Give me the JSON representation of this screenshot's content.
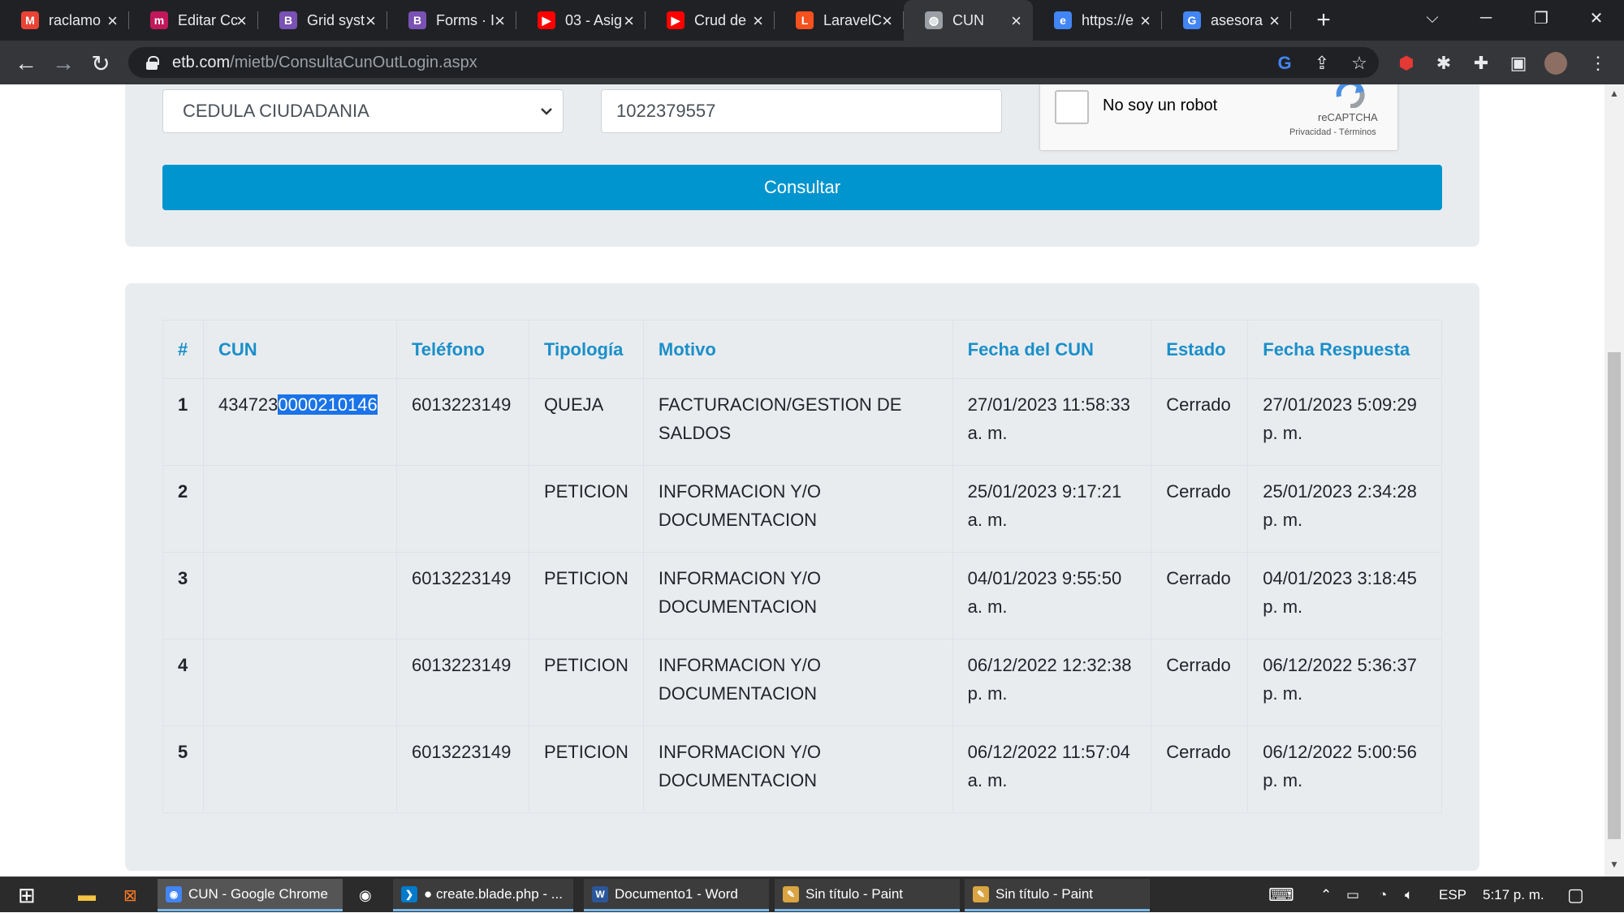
{
  "browser": {
    "tabs": [
      {
        "title": "raclamo",
        "favicon": "gmail-icon",
        "color": "#ea4335"
      },
      {
        "title": "Editar Cc",
        "favicon": "moodle-icon",
        "color": "#c2185b"
      },
      {
        "title": "Grid syst",
        "favicon": "bootstrap-icon",
        "color": "#7952b3"
      },
      {
        "title": "Forms · I",
        "favicon": "bootstrap-icon",
        "color": "#7952b3"
      },
      {
        "title": "03 - Asig",
        "favicon": "youtube-icon",
        "color": "#ff0000"
      },
      {
        "title": "Crud de",
        "favicon": "youtube-icon",
        "color": "#ff0000"
      },
      {
        "title": "LaravelC",
        "favicon": "laravel-icon",
        "color": "#f4511e"
      },
      {
        "title": "CUN",
        "favicon": "globe-icon",
        "color": "#9aa0a6"
      },
      {
        "title": "https://e",
        "favicon": "edge-icon",
        "color": "#4285f4"
      },
      {
        "title": "asesora",
        "favicon": "google-icon",
        "color": "#4285f4"
      }
    ],
    "url_domain": "etb.com",
    "url_path": "/mietb/ConsultaCunOutLogin.aspx"
  },
  "form": {
    "doc_type": "CEDULA CIUDADANIA",
    "doc_number": "1022379557",
    "recaptcha_label": "No soy un robot",
    "recaptcha_brand": "reCAPTCHA",
    "recaptcha_terms": "Privacidad - Términos",
    "submit_label": "Consultar"
  },
  "results": {
    "headers": [
      "#",
      "CUN",
      "Teléfono",
      "Tipología",
      "Motivo",
      "Fecha del CUN",
      "Estado",
      "Fecha Respuesta"
    ],
    "rows": [
      {
        "num": "1",
        "cun_prefix": "434723",
        "cun_selected": "0000210146",
        "telefono": "6013223149",
        "tipologia": "QUEJA",
        "motivo": "FACTURACION/GESTION DE SALDOS",
        "fecha_cun": "27/01/2023 11:58:33 a. m.",
        "estado": "Cerrado",
        "fecha_respuesta": "27/01/2023 5:09:29 p. m."
      },
      {
        "num": "2",
        "cun_prefix": "",
        "cun_selected": "",
        "telefono": "",
        "tipologia": "PETICION",
        "motivo": "INFORMACION Y/O DOCUMENTACION",
        "fecha_cun": "25/01/2023 9:17:21 a. m.",
        "estado": "Cerrado",
        "fecha_respuesta": "25/01/2023 2:34:28 p. m."
      },
      {
        "num": "3",
        "cun_prefix": "",
        "cun_selected": "",
        "telefono": "6013223149",
        "tipologia": "PETICION",
        "motivo": "INFORMACION Y/O DOCUMENTACION",
        "fecha_cun": "04/01/2023 9:55:50 a. m.",
        "estado": "Cerrado",
        "fecha_respuesta": "04/01/2023 3:18:45 p. m."
      },
      {
        "num": "4",
        "cun_prefix": "",
        "cun_selected": "",
        "telefono": "6013223149",
        "tipologia": "PETICION",
        "motivo": "INFORMACION Y/O DOCUMENTACION",
        "fecha_cun": "06/12/2022 12:32:38 p. m.",
        "estado": "Cerrado",
        "fecha_respuesta": "06/12/2022 5:36:37 p. m."
      },
      {
        "num": "5",
        "cun_prefix": "",
        "cun_selected": "",
        "telefono": "6013223149",
        "tipologia": "PETICION",
        "motivo": "INFORMACION Y/O DOCUMENTACION",
        "fecha_cun": "06/12/2022 11:57:04 a. m.",
        "estado": "Cerrado",
        "fecha_respuesta": "06/12/2022 5:00:56 p. m."
      }
    ]
  },
  "taskbar": {
    "items": [
      {
        "label": "CUN - Google Chrome",
        "icon": "chrome-icon",
        "color": "#4285f4",
        "active": true
      },
      {
        "label": "● create.blade.php - ...",
        "icon": "vscode-icon",
        "color": "#007acc",
        "active": false
      },
      {
        "label": "Documento1 - Word",
        "icon": "word-icon",
        "color": "#2b579a",
        "active": false
      },
      {
        "label": "Sin título - Paint",
        "icon": "paint-icon",
        "color": "#d9a441",
        "active": false
      },
      {
        "label": "Sin título - Paint",
        "icon": "paint-icon",
        "color": "#d9a441",
        "active": false
      }
    ],
    "language": "ESP",
    "time": "5:17 p. m."
  }
}
